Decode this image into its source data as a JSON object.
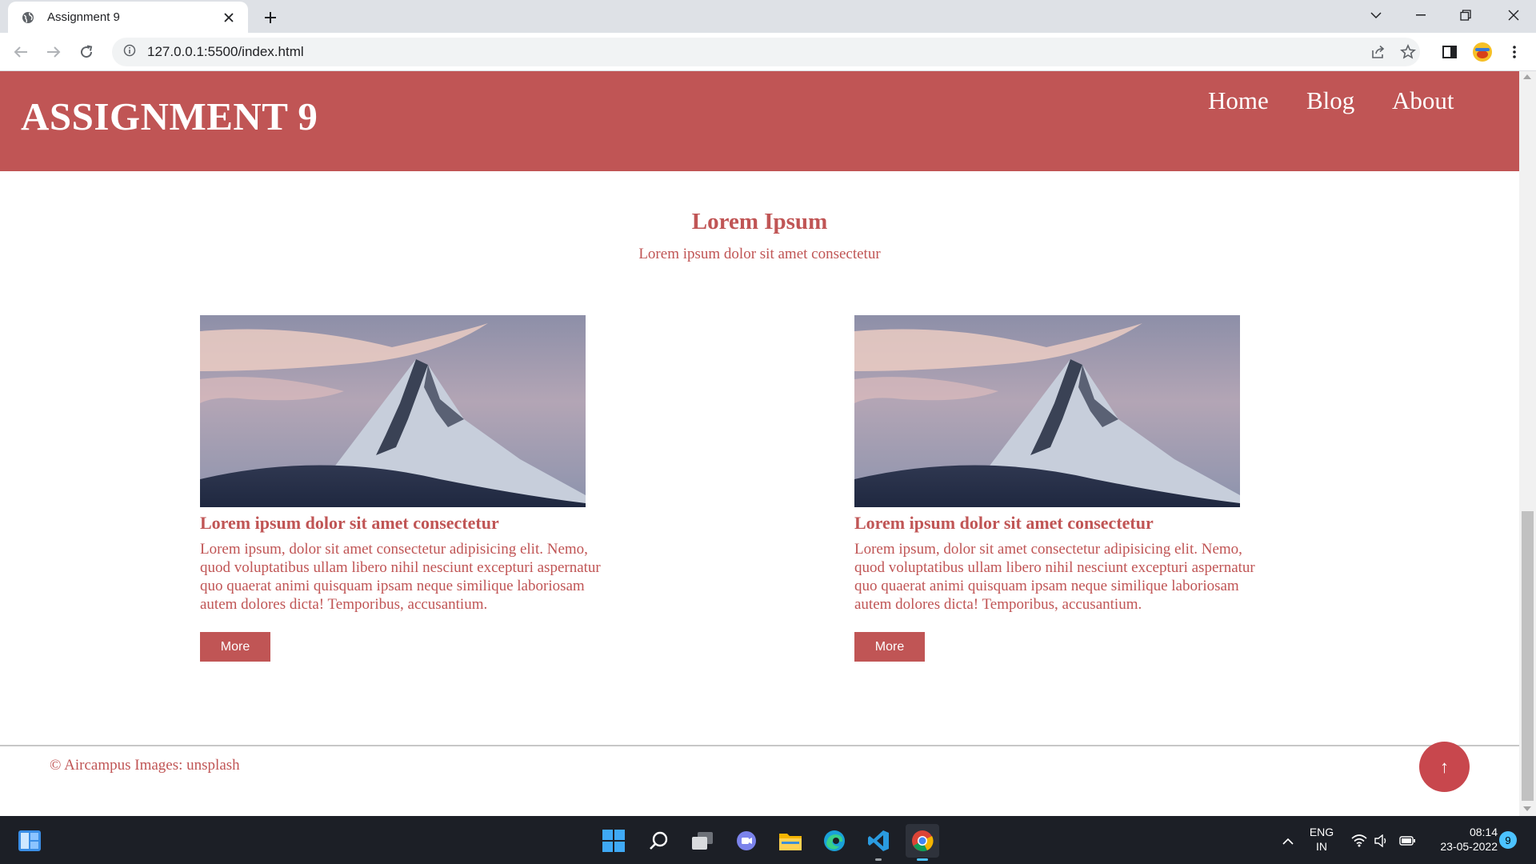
{
  "browser": {
    "tab_title": "Assignment 9",
    "url": "127.0.0.1:5500/index.html"
  },
  "site": {
    "logo": "ASSIGNMENT 9",
    "nav": [
      "Home",
      "Blog",
      "About"
    ],
    "section_title": "Lorem Ipsum",
    "section_subtitle": "Lorem ipsum dolor sit amet consectetur",
    "cards": [
      {
        "title": "Lorem ipsum dolor sit amet consectetur",
        "text": "Lorem ipsum, dolor sit amet consectetur adipisicing elit. Nemo, quod voluptatibus ullam libero nihil nesciunt excepturi aspernatur quo quaerat animi quisquam ipsam neque similique laboriosam autem dolores dicta! Temporibus, accusantium.",
        "button": "More"
      },
      {
        "title": "Lorem ipsum dolor sit amet consectetur",
        "text": "Lorem ipsum, dolor sit amet consectetur adipisicing elit. Nemo, quod voluptatibus ullam libero nihil nesciunt excepturi aspernatur quo quaerat animi quisquam ipsam neque similique laboriosam autem dolores dicta! Temporibus, accusantium.",
        "button": "More"
      }
    ],
    "footer": "© Aircampus Images: unsplash",
    "to_top": "↑"
  },
  "taskbar": {
    "lang_top": "ENG",
    "lang_bottom": "IN",
    "time": "08:14",
    "date": "23-05-2022",
    "notifications": "9"
  },
  "colors": {
    "brand": "#c05555",
    "to_top": "#c8474d",
    "taskbar": "#1c1f26"
  }
}
